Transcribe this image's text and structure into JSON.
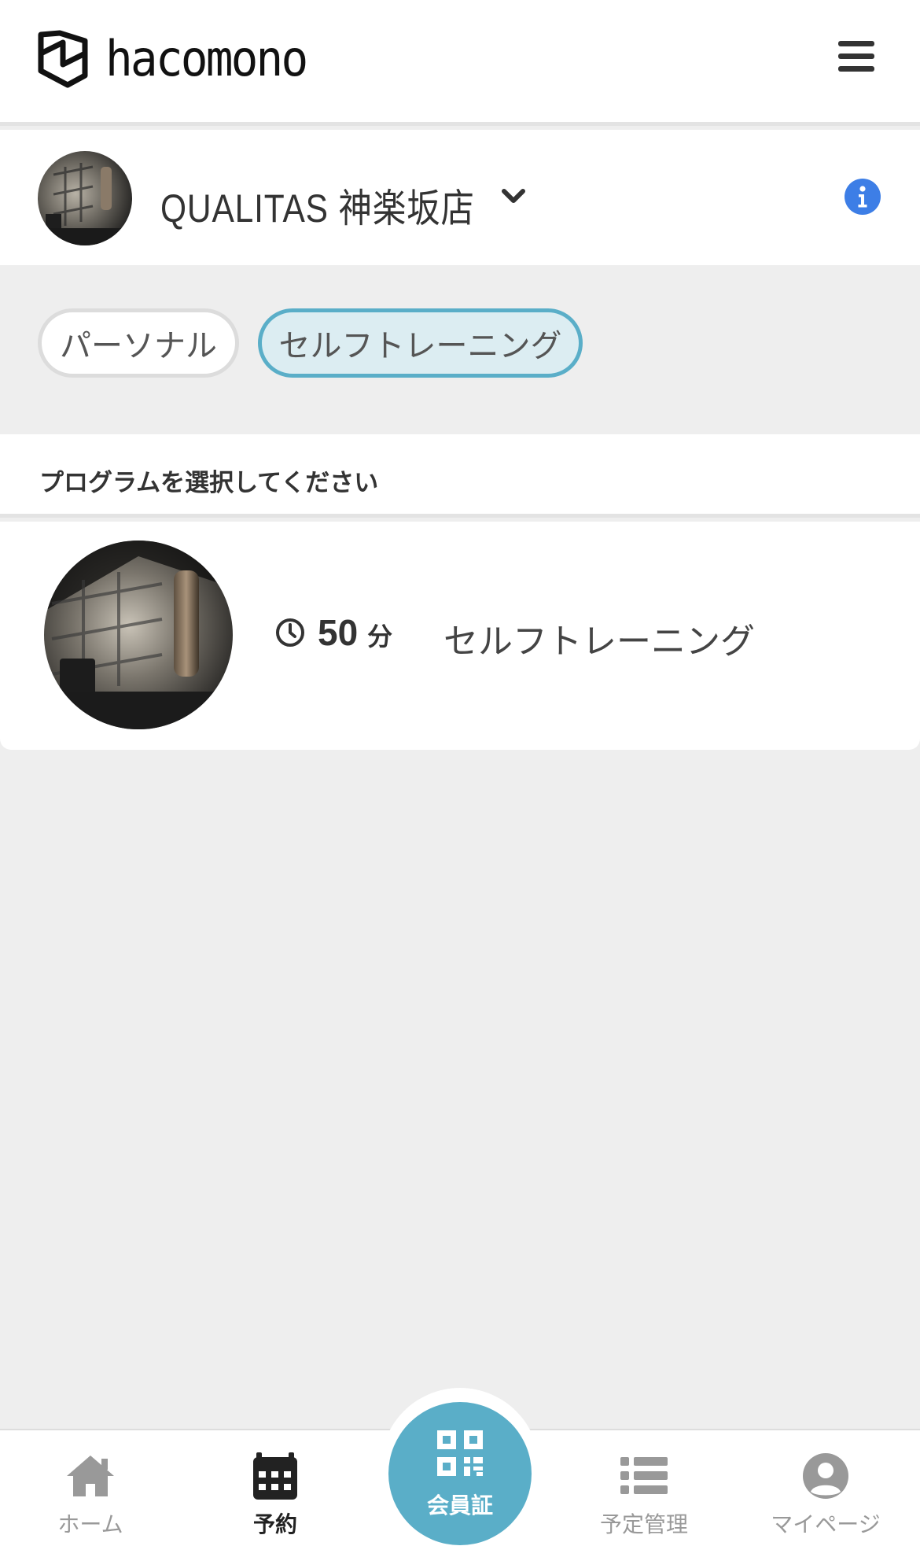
{
  "header": {
    "brand": "hacomono",
    "logo_icon": "hacomono-logo-icon",
    "menu_icon": "hamburger-menu-icon"
  },
  "studio": {
    "name": "QUALITAS 神楽坂店",
    "avatar_icon": "studio-photo",
    "dropdown_icon": "chevron-down-icon",
    "info_icon": "info-icon"
  },
  "categories": [
    {
      "label": "パーソナル",
      "selected": false
    },
    {
      "label": "セルフトレーニング",
      "selected": true
    }
  ],
  "section": {
    "title": "プログラムを選択してください"
  },
  "programs": [
    {
      "duration": "50",
      "unit": "分",
      "name": "セルフトレーニング",
      "icon": "clock-icon"
    }
  ],
  "bottom_nav": {
    "items": [
      {
        "label": "ホーム",
        "icon": "home-icon",
        "active": false
      },
      {
        "label": "予約",
        "icon": "calendar-icon",
        "active": true
      },
      {
        "label": "会員証",
        "icon": "qr-code-icon",
        "active": false
      },
      {
        "label": "予定管理",
        "icon": "list-icon",
        "active": false
      },
      {
        "label": "マイページ",
        "icon": "user-icon",
        "active": false
      }
    ]
  },
  "colors": {
    "accent": "#5aaec8",
    "accent_light": "#dcedf2",
    "info_blue": "#3d7ee6",
    "background": "#eeeeee",
    "text": "#333333",
    "inactive_nav": "#999999"
  }
}
